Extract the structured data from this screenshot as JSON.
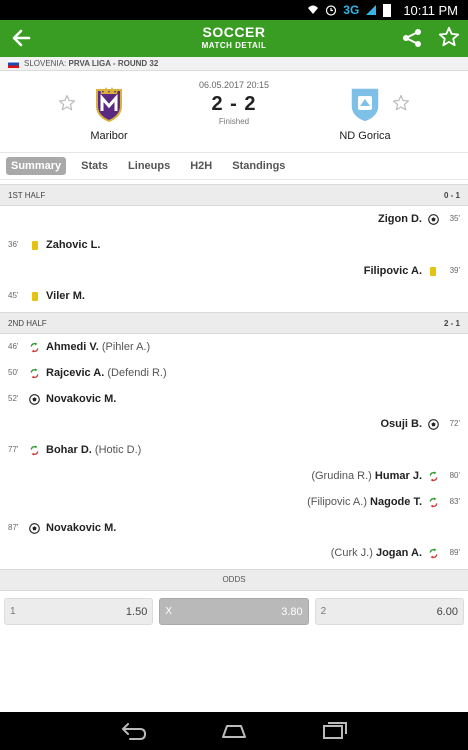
{
  "status_bar": {
    "network": "3G",
    "time": "10:11 PM"
  },
  "header": {
    "title": "SOCCER",
    "subtitle": "MATCH DETAIL"
  },
  "league": {
    "country": "SLOVENIA:",
    "competition": "PRVA LIGA - ROUND 32"
  },
  "match": {
    "date": "06.05.2017 20:15",
    "score": "2 - 2",
    "status": "Finished",
    "home": {
      "name": "Maribor"
    },
    "away": {
      "name": "ND Gorica"
    }
  },
  "tabs": [
    "Summary",
    "Stats",
    "Lineups",
    "H2H",
    "Standings"
  ],
  "first_half": {
    "label": "1ST HALF",
    "score": "0 - 1",
    "events": [
      {
        "side": "away",
        "minute": "35'",
        "type": "goal",
        "player": "Zigon D.",
        "sub": ""
      },
      {
        "side": "home",
        "minute": "36'",
        "type": "yellow",
        "player": "Zahovic L.",
        "sub": ""
      },
      {
        "side": "away",
        "minute": "39'",
        "type": "yellow",
        "player": "Filipovic A.",
        "sub": ""
      },
      {
        "side": "home",
        "minute": "45'",
        "type": "yellow",
        "player": "Viler M.",
        "sub": ""
      }
    ]
  },
  "second_half": {
    "label": "2ND HALF",
    "score": "2 - 1",
    "events": [
      {
        "side": "home",
        "minute": "46'",
        "type": "sub",
        "player": "Ahmedi V.",
        "sub": "(Pihler A.)"
      },
      {
        "side": "home",
        "minute": "50'",
        "type": "sub",
        "player": "Rajcevic A.",
        "sub": "(Defendi R.)"
      },
      {
        "side": "home",
        "minute": "52'",
        "type": "goal",
        "player": "Novakovic M.",
        "sub": ""
      },
      {
        "side": "away",
        "minute": "72'",
        "type": "goal",
        "player": "Osuji B.",
        "sub": ""
      },
      {
        "side": "home",
        "minute": "77'",
        "type": "sub",
        "player": "Bohar D.",
        "sub": "(Hotic D.)"
      },
      {
        "side": "away",
        "minute": "80'",
        "type": "sub",
        "player": "Humar J.",
        "sub": "(Grudina R.)"
      },
      {
        "side": "away",
        "minute": "83'",
        "type": "sub",
        "player": "Nagode T.",
        "sub": "(Filipovic A.)"
      },
      {
        "side": "home",
        "minute": "87'",
        "type": "goal",
        "player": "Novakovic M.",
        "sub": ""
      },
      {
        "side": "away",
        "minute": "89'",
        "type": "sub",
        "player": "Jogan A.",
        "sub": "(Curk J.)"
      }
    ]
  },
  "odds": {
    "label": "ODDS",
    "items": [
      {
        "key": "1",
        "value": "1.50",
        "selected": false
      },
      {
        "key": "X",
        "value": "3.80",
        "selected": true
      },
      {
        "key": "2",
        "value": "6.00",
        "selected": false
      }
    ]
  },
  "colors": {
    "header": "#3a9d23",
    "yellow_card": "#e6c214",
    "sub_in": "#2e9d2e",
    "sub_out": "#d23c3c"
  }
}
